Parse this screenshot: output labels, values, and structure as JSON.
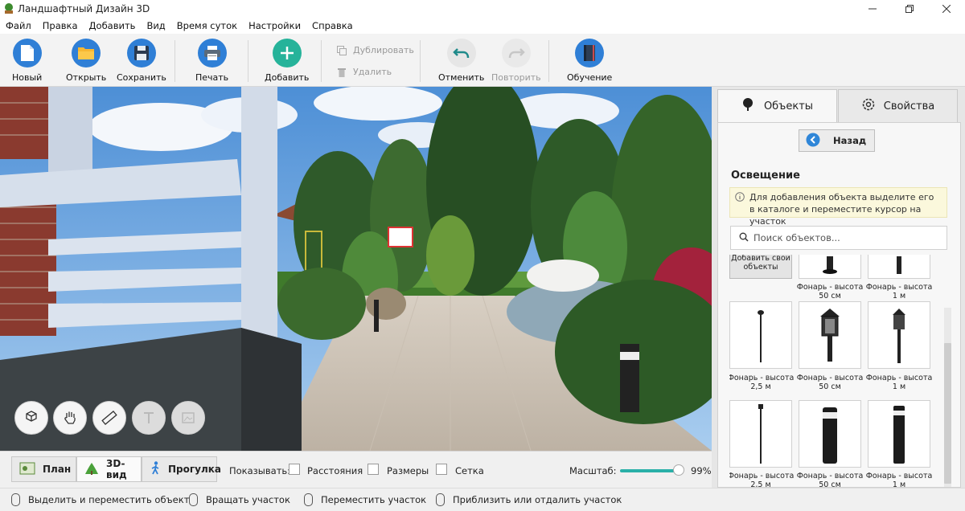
{
  "window": {
    "title": "Ландшафтный Дизайн 3D"
  },
  "menu": [
    "Файл",
    "Правка",
    "Добавить",
    "Вид",
    "Время суток",
    "Настройки",
    "Справка"
  ],
  "toolbar": {
    "new": "Новый",
    "open": "Открыть",
    "save": "Сохранить",
    "print": "Печать",
    "add": "Добавить",
    "duplicate": "Дублировать",
    "delete": "Удалить",
    "undo": "Отменить",
    "redo": "Повторить",
    "learn": "Обучение"
  },
  "viewbar": {
    "tabs": [
      "План",
      "3D-вид",
      "Прогулка"
    ],
    "active_tab": "3D-вид",
    "show_label": "Показывать:",
    "checkboxes": [
      "Расстояния",
      "Размеры",
      "Сетка"
    ],
    "scale_label": "Масштаб:",
    "scale_value": "99%",
    "scale_fraction": 0.99
  },
  "statusbar": [
    "Выделить и переместить объект",
    "Вращать участок",
    "Переместить участок",
    "Приблизить или отдалить участок"
  ],
  "panel": {
    "tabs": [
      "Объекты",
      "Свойства"
    ],
    "back": "Назад",
    "section": "Освещение",
    "hint": "Для добавления объекта выделите его в каталоге и переместите курсор на участок",
    "search_placeholder": "Поиск объектов...",
    "add_own": "Добавить свои объекты",
    "items": [
      {
        "label": "Фонарь - высота 50 см"
      },
      {
        "label": "Фонарь - высота 1 м"
      },
      {
        "label": "Фонарь - высота 2,5 м"
      },
      {
        "label": "Фонарь - высота 50 см"
      },
      {
        "label": "Фонарь - высота 1 м"
      },
      {
        "label": "Фонарь - высота 2,5 м"
      },
      {
        "label": "Фонарь - высота 50 см"
      },
      {
        "label": "Фонарь - высота 1 м"
      }
    ]
  },
  "colors": {
    "accent": "#2ab0a8",
    "toolbar_blue": "#2f7fd6",
    "hint_bg": "#fbf8dc"
  }
}
